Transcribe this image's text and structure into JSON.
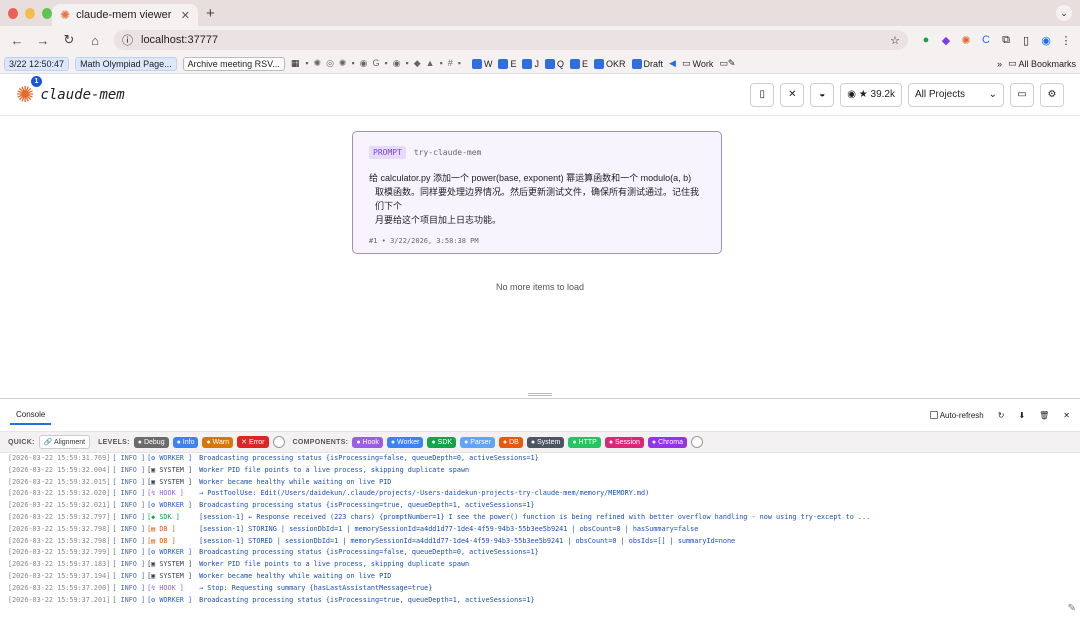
{
  "browser": {
    "tab_title": "claude-mem viewer",
    "url": "localhost:37777",
    "bookmark_chips": [
      "3/22 12:50:47",
      "Math Olympiad Page...",
      "Archive meeting RSV..."
    ],
    "bookmarks": [
      {
        "label": "W",
        "color": "#2f6fdc"
      },
      {
        "label": "E",
        "color": "#2f6fdc"
      },
      {
        "label": "J",
        "color": "#2f6fdc"
      },
      {
        "label": "Q",
        "color": "#2f6fdc"
      },
      {
        "label": "E",
        "color": "#2f6fdc"
      },
      {
        "label": "OKR",
        "color": "#2f6fdc"
      },
      {
        "label": "Draft",
        "color": "#2f6fdc"
      },
      {
        "label": "Work",
        "color": "#555"
      }
    ],
    "all_bookmarks": "All Bookmarks"
  },
  "header": {
    "app_name": "claude-mem",
    "badge_count": "1",
    "stars": "39.2k",
    "project_select": "All Projects"
  },
  "card": {
    "type": "PROMPT",
    "project": "try-claude-mem",
    "text_line1": "给 calculator.py 添加一个 power(base, exponent) 幂运算函数和一个 modulo(a, b)",
    "text_line2": "取模函数。同样要处理边界情况。然后更新测试文件，确保所有测试通过。记住我们下个",
    "text_line3": "月要给这个项目加上日志功能。",
    "meta": "#1 • 3/22/2026, 3:58:38 PM"
  },
  "no_more": "No more items to load",
  "console": {
    "tab": "Console",
    "auto_refresh": "Auto-refresh",
    "quick_label": "QUICK:",
    "quick_alignment": "Alignment",
    "levels_label": "LEVELS:",
    "levels": [
      {
        "label": "Debug",
        "color": "#6b6b6b"
      },
      {
        "label": "Info",
        "color": "#3b82f6"
      },
      {
        "label": "Warn",
        "color": "#d97706"
      },
      {
        "label": "Error",
        "color": "#dc2626"
      }
    ],
    "components_label": "COMPONENTS:",
    "components": [
      {
        "label": "Hook",
        "color": "#9b5de5"
      },
      {
        "label": "Worker",
        "color": "#3b82f6"
      },
      {
        "label": "SDK",
        "color": "#16a34a"
      },
      {
        "label": "Parser",
        "color": "#60a5fa"
      },
      {
        "label": "DB",
        "color": "#ea580c"
      },
      {
        "label": "System",
        "color": "#4b5563"
      },
      {
        "label": "HTTP",
        "color": "#22c55e"
      },
      {
        "label": "Session",
        "color": "#db2777"
      },
      {
        "label": "Chroma",
        "color": "#9333ea"
      }
    ],
    "logs": [
      {
        "ts": "[2026-03-22 15:59:31.769]",
        "lvl": "[ INFO ]",
        "comp": "[⚙ WORKER ]",
        "ccolor": "#2563eb",
        "msg": "Broadcasting processing status {isProcessing=false, queueDepth=0, activeSessions=1}"
      },
      {
        "ts": "[2026-03-22 15:59:32.004]",
        "lvl": "[ INFO ]",
        "comp": "[▣ SYSTEM ]",
        "ccolor": "#374151",
        "msg": "Worker PID file points to a live process, skipping duplicate spawn"
      },
      {
        "ts": "[2026-03-22 15:59:32.015]",
        "lvl": "[ INFO ]",
        "comp": "[▣ SYSTEM ]",
        "ccolor": "#374151",
        "msg": "Worker became healthy while waiting on live PID"
      },
      {
        "ts": "[2026-03-22 15:59:32.020]",
        "lvl": "[ INFO ]",
        "comp": "[↯ HOOK   ]",
        "ccolor": "#9b5de5",
        "msg": "→ PostToolUse: Edit(/Users/daidekun/.claude/projects/-Users-daidekun-projects-try-claude-mem/memory/MEMORY.md)"
      },
      {
        "ts": "[2026-03-22 15:59:32.021]",
        "lvl": "[ INFO ]",
        "comp": "[⚙ WORKER ]",
        "ccolor": "#2563eb",
        "msg": "Broadcasting processing status {isProcessing=true, queueDepth=1, activeSessions=1}"
      },
      {
        "ts": "[2026-03-22 15:59:32.797]",
        "lvl": "[ INFO ]",
        "comp": "[◆ SDK    ]",
        "ccolor": "#16a34a",
        "msg": "[session-1] ← Response received (223 chars) {promptNumber=1} I see the power() function is being refined with better overflow handling - now using try-except to ..."
      },
      {
        "ts": "[2026-03-22 15:59:32.798]",
        "lvl": "[ INFO ]",
        "comp": "[▤ DB     ]",
        "ccolor": "#ea580c",
        "msg": "[session-1] STORING | sessionDbId=1 | memorySessionId=a4dd1d77-1de4-4f59-94b3-55b3ee5b9241 | obsCount=0 | hasSummary=false"
      },
      {
        "ts": "[2026-03-22 15:59:32.798]",
        "lvl": "[ INFO ]",
        "comp": "[▤ DB     ]",
        "ccolor": "#ea580c",
        "msg": "[session-1] STORED | sessionDbId=1 | memorySessionId=a4dd1d77-1de4-4f59-94b3-55b3ee5b9241 | obsCount=0 | obsIds=[] | summaryId=none"
      },
      {
        "ts": "[2026-03-22 15:59:32.799]",
        "lvl": "[ INFO ]",
        "comp": "[⚙ WORKER ]",
        "ccolor": "#2563eb",
        "msg": "Broadcasting processing status {isProcessing=false, queueDepth=0, activeSessions=1}"
      },
      {
        "ts": "[2026-03-22 15:59:37.183]",
        "lvl": "[ INFO ]",
        "comp": "[▣ SYSTEM ]",
        "ccolor": "#374151",
        "msg": "Worker PID file points to a live process, skipping duplicate spawn"
      },
      {
        "ts": "[2026-03-22 15:59:37.194]",
        "lvl": "[ INFO ]",
        "comp": "[▣ SYSTEM ]",
        "ccolor": "#374151",
        "msg": "Worker became healthy while waiting on live PID"
      },
      {
        "ts": "[2026-03-22 15:59:37.200]",
        "lvl": "[ INFO ]",
        "comp": "[↯ HOOK   ]",
        "ccolor": "#9b5de5",
        "msg": "→ Stop: Requesting summary {hasLastAssistantMessage=true}"
      },
      {
        "ts": "[2026-03-22 15:59:37.201]",
        "lvl": "[ INFO ]",
        "comp": "[⚙ WORKER ]",
        "ccolor": "#2563eb",
        "msg": "Broadcasting processing status {isProcessing=true, queueDepth=1, activeSessions=1}"
      }
    ]
  }
}
